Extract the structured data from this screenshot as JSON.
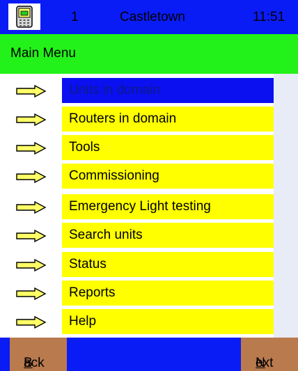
{
  "status_bar": {
    "icon": "pda-icon",
    "number": "1",
    "location": "Castletown",
    "time": "11:51"
  },
  "header": {
    "title": "Main Menu"
  },
  "menu": {
    "items": [
      {
        "label": "Units in domain",
        "selected": true
      },
      {
        "label": "Routers in domain"
      },
      {
        "label": "Tools"
      },
      {
        "label": "Commissioning"
      },
      {
        "label": "Emergency Light testing"
      },
      {
        "label": "Search units"
      },
      {
        "label": "Status"
      },
      {
        "label": "Reports"
      },
      {
        "label": "Help"
      }
    ]
  },
  "footer": {
    "back_key": "B",
    "back_rest": "ack",
    "next_key": "N",
    "next_rest": "ext"
  },
  "colors": {
    "status_bar": "#0a1cf5",
    "header": "#22f219",
    "menu_item": "#ffff00",
    "menu_item_selected": "#0a10f0",
    "footer_button": "#b97a4e"
  }
}
